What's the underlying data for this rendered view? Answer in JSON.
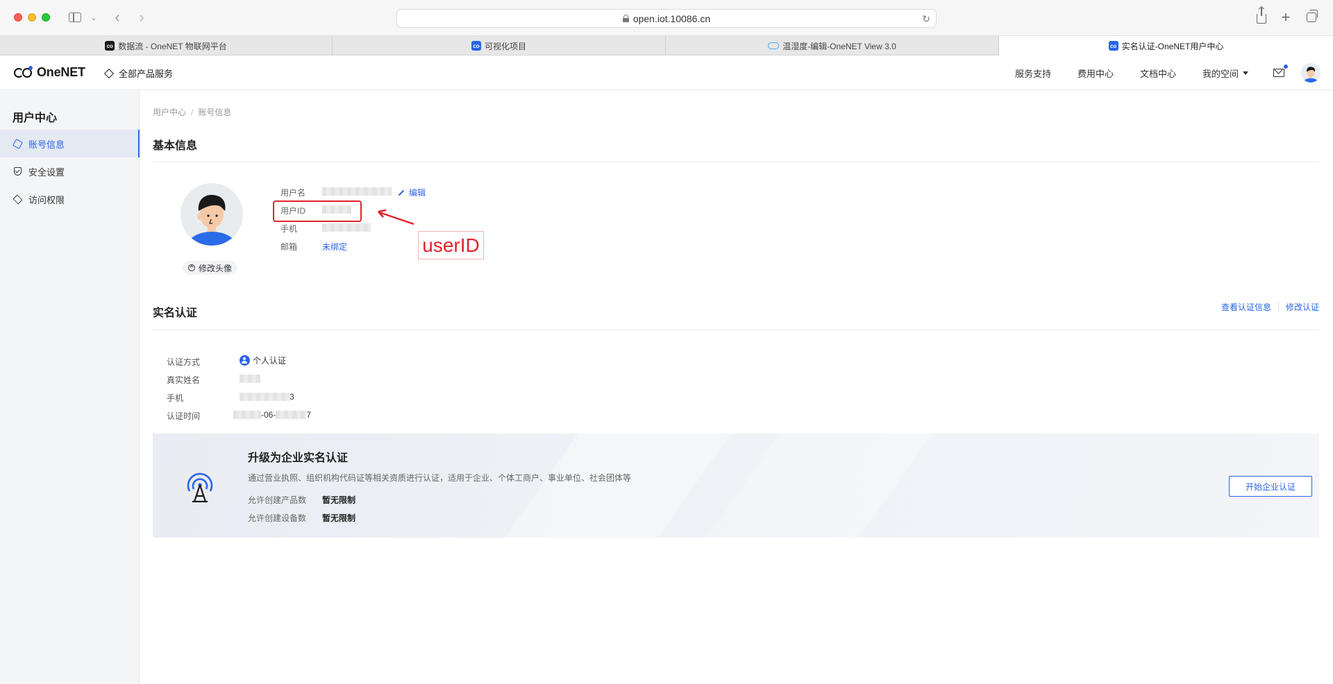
{
  "browser": {
    "url": "open.iot.10086.cn",
    "tabs": [
      {
        "label": "数据流 - OneNET 物联网平台",
        "favicon": "onenet-black",
        "active": false
      },
      {
        "label": "可视化项目",
        "favicon": "onenet-blue",
        "active": false
      },
      {
        "label": "温湿度-编辑-OneNET View 3.0",
        "favicon": "cloud-icon",
        "active": false
      },
      {
        "label": "实名认证-OneNET用户中心",
        "favicon": "onenet-blue",
        "active": true
      }
    ]
  },
  "header": {
    "logo": "OneNET",
    "all_products": "全部产品服务",
    "nav": [
      "服务支持",
      "费用中心",
      "文档中心",
      "我的空间"
    ],
    "accent": "#2a64e8"
  },
  "sidebar": {
    "title": "用户中心",
    "items": [
      {
        "label": "账号信息",
        "icon": "hexagon-icon",
        "active": true
      },
      {
        "label": "安全设置",
        "icon": "shield-icon",
        "active": false
      },
      {
        "label": "访问权限",
        "icon": "layers-icon",
        "active": false
      }
    ]
  },
  "breadcrumb": [
    "用户中心",
    "账号信息"
  ],
  "basic_info": {
    "title": "基本信息",
    "change_avatar": "修改头像",
    "labels": {
      "username": "用户名",
      "user_id": "用户ID",
      "phone": "手机",
      "email": "邮箱"
    },
    "edit": "编辑",
    "email_value": "未绑定",
    "annotation": "userID"
  },
  "realname": {
    "title": "实名认证",
    "view_link": "查看认证信息",
    "modify_link": "修改认证",
    "labels": {
      "method": "认证方式",
      "name": "真实姓名",
      "phone": "手机",
      "time": "认证时间"
    },
    "method_value": "个人认证",
    "phone_suffix": "3",
    "time_mid": "-06-",
    "time_suffix": "7"
  },
  "upgrade": {
    "title": "升级为企业实名认证",
    "desc": "通过营业执照、组织机构代码证等相关资质进行认证，适用于企业、个体工商户、事业单位、社会团体等",
    "rows": [
      {
        "label": "允许创建产品数",
        "value": "暂无限制"
      },
      {
        "label": "允许创建设备数",
        "value": "暂无限制"
      }
    ],
    "button": "开始企业认证"
  }
}
